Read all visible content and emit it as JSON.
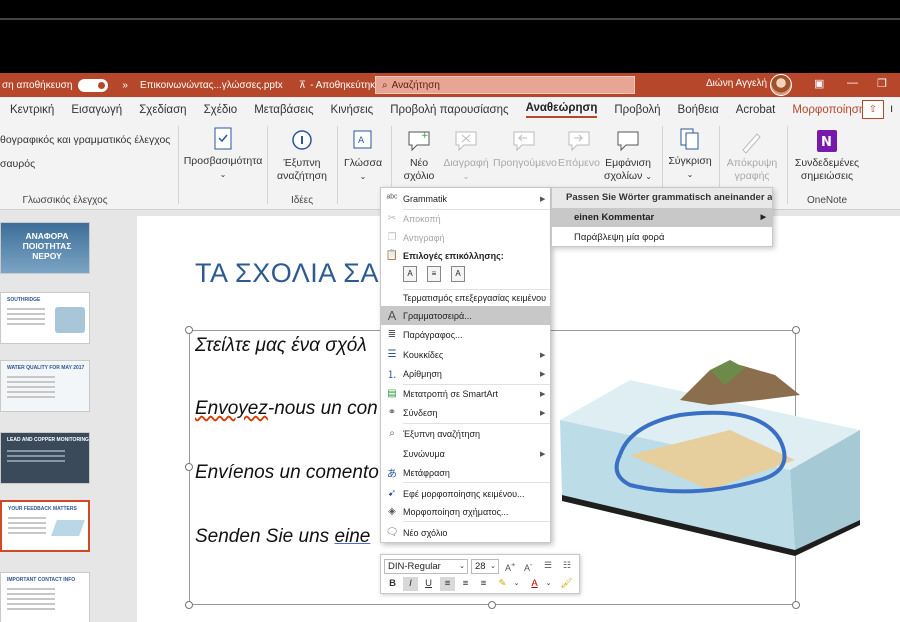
{
  "titlebar": {
    "autosave_label": "ση αποθήκευση",
    "filename": "Επικοινωνώντας...γλώσσες.pptx",
    "save_status": "- Αποθηκεύτηκε",
    "search_placeholder": "Αναζήτηση",
    "user_name": "Διώνη Αγγελή"
  },
  "tabs": [
    "Κεντρική",
    "Εισαγωγή",
    "Σχεδίαση",
    "Σχέδιο",
    "Μεταβάσεις",
    "Κινήσεις",
    "Προβολή παρουσίασης",
    "Αναθεώρηση",
    "Προβολή",
    "Βοήθεια",
    "Acrobat",
    "Μορφοποίηση"
  ],
  "active_tab": "Αναθεώρηση",
  "ribbon": {
    "spelling": "θογραφικός και γραμματικός έλεγχος",
    "thesaurus": "σαυρός",
    "group_proofing": "Γλωσσικός έλεγχος",
    "accessibility": "Προσβασιμότητα",
    "smart_lookup_1": "Έξυπνη",
    "smart_lookup_2": "αναζήτηση",
    "group_insights": "Ιδέες",
    "language": "Γλώσσα",
    "new_comment_1": "Νέο",
    "new_comment_2": "σχόλιο",
    "delete": "Διαγραφή",
    "previous": "Προηγούμενο",
    "next": "Επόμενο",
    "show_comments_1": "Εμφάνιση",
    "show_comments_2": "σχολίων",
    "compare": "Σύγκριση",
    "hide_ink_1": "Απόκρυψη",
    "hide_ink_2": "γραφής",
    "linked_notes_1": "Συνδεδεμένες",
    "linked_notes_2": "σημειώσεις",
    "group_onenote": "OneNote"
  },
  "slides": {
    "thumb1_title_1": "ΑΝΑΦΟΡΑ",
    "thumb1_title_2": "ΠΟΙΟΤΗΤΑΣ ΝΕΡΟΥ",
    "thumb2_title": "SOUTHRIDGE",
    "thumb3_title": "WATER QUALITY FOR MAY 2017",
    "thumb4_title": "LEAD AND COPPER MONITORING",
    "thumb5_title": "YOUR FEEDBACK MATTERS",
    "thumb6_title": "IMPORTANT CONTACT INFO"
  },
  "slide": {
    "title": "ΤΑ ΣΧΟΛΙΑ ΣΑ",
    "line_greek": "Στείλτε μας ένα σχόλ",
    "line_french_1": "Envoyez",
    "line_french_2": "-nous un con",
    "line_spanish": "Envíenos un comento",
    "line_german_1": "Senden Sie uns ",
    "line_german_2": "eine"
  },
  "context_menu": {
    "grammar": "Grammatik",
    "cut": "Αποκοπή",
    "copy": "Αντιγραφή",
    "paste_options": "Επιλογές επικόλλησης:",
    "exit_edit": "Τερματισμός επεξεργασίας κειμένου",
    "font": "Γραμματοσειρά...",
    "paragraph": "Παράγραφος...",
    "bullets": "Κουκκίδες",
    "numbering": "Αρίθμηση",
    "smartart": "Μετατροπή σε SmartArt",
    "link": "Σύνδεση",
    "smart_lookup": "Έξυπνη αναζήτηση",
    "synonyms": "Συνώνυμα",
    "translate": "Μετάφραση",
    "text_effects": "Εφέ μορφοποίησης κειμένου...",
    "shape_format": "Μορφοποίηση σχήματος...",
    "new_comment": "Νέο σχόλιο"
  },
  "submenu": {
    "header": "Passen Sie Wörter grammatisch aneinander an.",
    "suggestion": "einen Kommentar",
    "ignore_once": "Παράβλεψη μία φορά"
  },
  "mini_toolbar": {
    "font": "DIN-Regular",
    "size": "28"
  },
  "colors": {
    "brand": "#b7472a",
    "title_blue": "#2e5b8f"
  }
}
